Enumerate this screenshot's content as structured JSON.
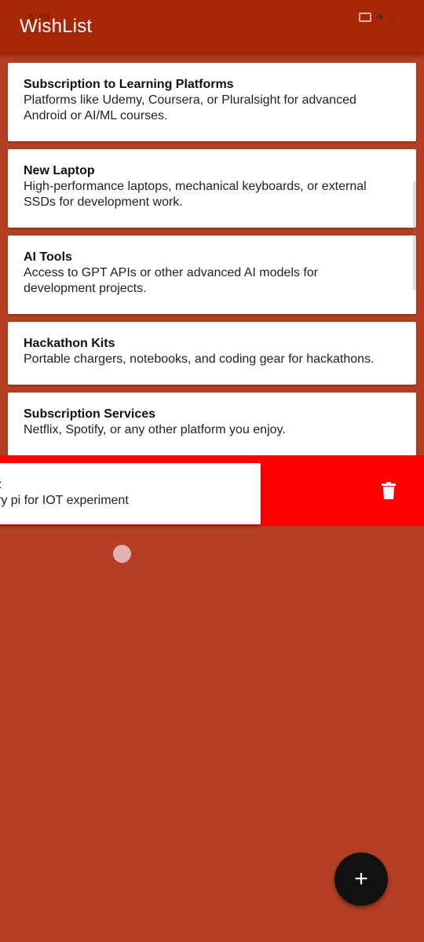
{
  "status_bar": {
    "time": "6:49",
    "icons": [
      "cast-icon",
      "airplane-icon",
      "loading-icon"
    ]
  },
  "app_bar": {
    "title": "WishList"
  },
  "wish_items": [
    {
      "title": "Subscription to Learning Platforms",
      "desc_line1": "Platforms like Udemy, Coursera, or Pluralsight for advanced",
      "desc_line2": "Android or AI/ML courses."
    },
    {
      "title": "New Laptop",
      "desc_line1": "High-performance laptops, mechanical keyboards, or external",
      "desc_line2": "SSDs for development work."
    },
    {
      "title": "AI Tools",
      "desc_line1": "Access to GPT APIs or other advanced AI models for",
      "desc_line2": "development projects."
    },
    {
      "title": "Hackathon Kits",
      "desc_line1": "Portable chargers, notebooks, and coding gear for hackathons."
    },
    {
      "title": "Subscription Services",
      "desc_line1": "Netflix, Spotify, or any other platform you enjoy."
    }
  ],
  "swiped_item": {
    "title_visible": "t",
    "desc_visible": "ry pi for IOT experiment",
    "action_icon": "trash-icon"
  },
  "fab": {
    "label": "+",
    "icon": "plus-icon"
  },
  "colors": {
    "app_bar": "#a82608",
    "background": "#b43f23",
    "delete_background": "#fe0000",
    "fab": "#111111"
  }
}
